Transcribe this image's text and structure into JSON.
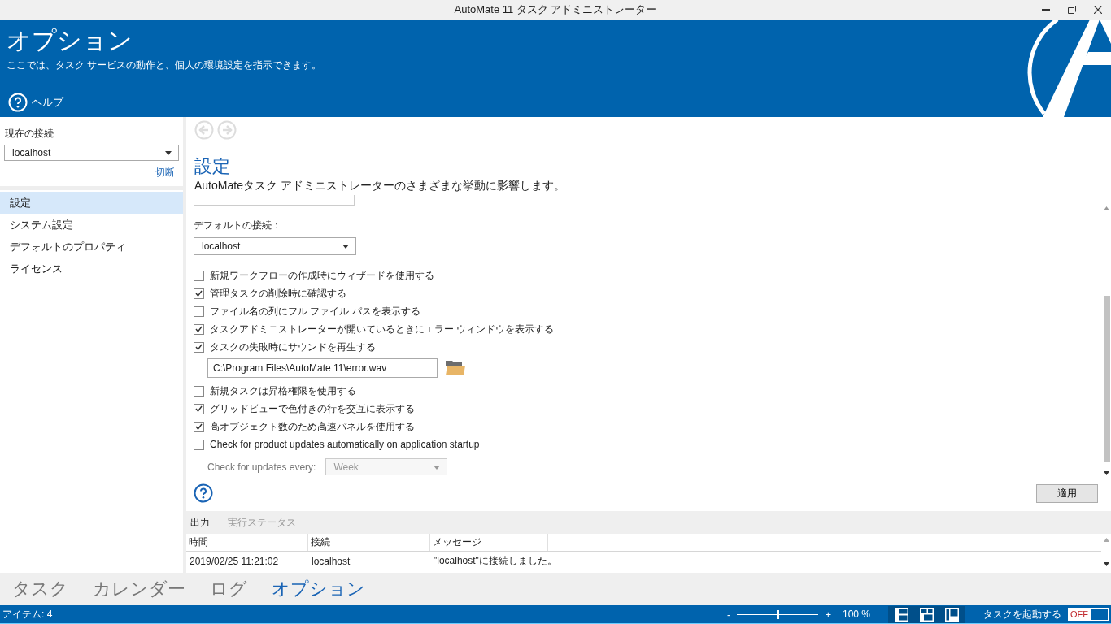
{
  "title_bar": {
    "title": "AutoMate 11 タスク アドミニストレーター"
  },
  "header": {
    "title": "オプション",
    "description": "ここでは、タスク サービスの動作と、個人の環境設定を指示できます。",
    "help_label": "ヘルプ"
  },
  "sidebar": {
    "connection_label": "現在の接続",
    "connection_value": "localhost",
    "disconnect_link": "切断",
    "items": [
      {
        "label": "設定",
        "selected": true
      },
      {
        "label": "システム設定",
        "selected": false
      },
      {
        "label": "デフォルトのプロパティ",
        "selected": false
      },
      {
        "label": "ライセンス",
        "selected": false
      }
    ]
  },
  "content": {
    "heading": "設定",
    "description": "AutoMateタスク アドミニストレーターのさまざまな挙動に影響します。",
    "default_connection_label": "デフォルトの接続：",
    "default_connection_value": "localhost",
    "options": [
      {
        "kind": "checkbox",
        "label": "新規ワークフローの作成時にウィザードを使用する",
        "checked": false
      },
      {
        "kind": "checkbox",
        "label": "管理タスクの削除時に確認する",
        "checked": true
      },
      {
        "kind": "checkbox",
        "label": "ファイル名の列にフル ファイル パスを表示する",
        "checked": false
      },
      {
        "kind": "checkbox",
        "label": "タスクアドミニストレーターが開いているときにエラー ウィンドウを表示する",
        "checked": true
      },
      {
        "kind": "checkbox",
        "label": "タスクの失敗時にサウンドを再生する",
        "checked": true
      },
      {
        "kind": "file",
        "value": "C:\\Program Files\\AutoMate 11\\error.wav"
      },
      {
        "kind": "checkbox",
        "label": "新規タスクは昇格権限を使用する",
        "checked": false
      },
      {
        "kind": "checkbox",
        "label": "グリッドビューで色付きの行を交互に表示する",
        "checked": true
      },
      {
        "kind": "checkbox",
        "label": "高オブジェクト数のため高速パネルを使用する",
        "checked": true
      },
      {
        "kind": "checkbox",
        "label": "Check for product updates automatically on application startup",
        "checked": false
      }
    ],
    "update_interval": {
      "label": "Check for updates every:",
      "value": "Week",
      "disabled": true
    },
    "apply_button": "適用"
  },
  "output": {
    "tabs": [
      {
        "label": "出力",
        "selected": true
      },
      {
        "label": "実行ステータス",
        "selected": false
      }
    ],
    "columns": [
      "時間",
      "接続",
      "メッセージ"
    ],
    "rows": [
      [
        "2019/02/25 11:21:02",
        "localhost",
        "\"localhost\"に接続しました。"
      ]
    ]
  },
  "bottom_nav": [
    {
      "label": "タスク",
      "selected": false
    },
    {
      "label": "カレンダー",
      "selected": false
    },
    {
      "label": "ログ",
      "selected": false
    },
    {
      "label": "オプション",
      "selected": true
    }
  ],
  "status_bar": {
    "items_count": "アイテム: 4",
    "zoom": {
      "minus": "-",
      "plus": "+",
      "level": 0.5,
      "reading": "100 %"
    },
    "start_tasks_label": "タスクを起動する",
    "toggle": {
      "on": false,
      "label": "OFF"
    }
  }
}
